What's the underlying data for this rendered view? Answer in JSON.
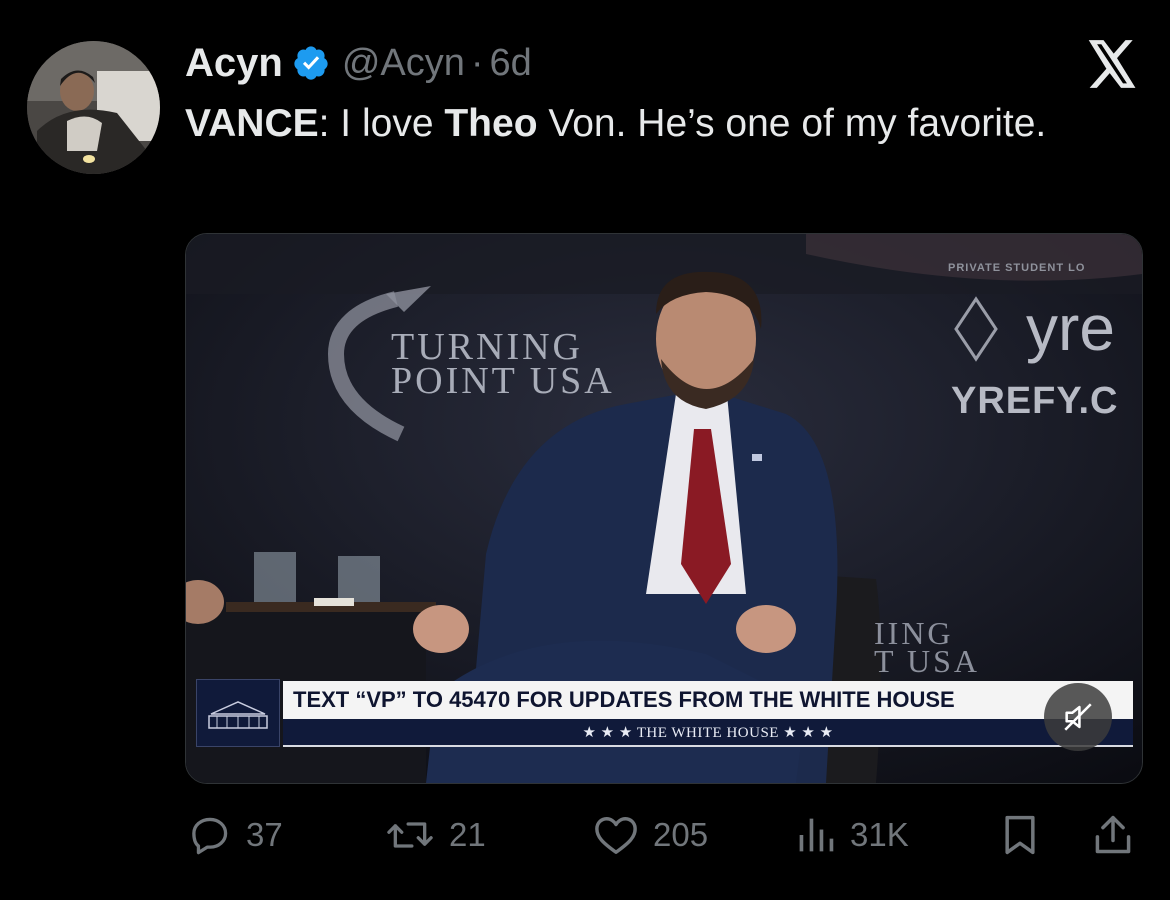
{
  "tweet": {
    "author_name": "Acyn",
    "author_handle": "@Acyn",
    "separator": "·",
    "age": "6d",
    "text_parts": {
      "p1_bold": "VANCE",
      "p2": ": I love ",
      "p3_bold": "Theo",
      "p4": " Von. He’s one of my favorite."
    }
  },
  "media": {
    "backdrop_left_line1": "TURNING",
    "backdrop_left_line2": "POINT USA",
    "backdrop_right_small": "PRIVATE STUDENT LO",
    "backdrop_right_logo": "yre",
    "backdrop_right_url": "YREFY.C",
    "backdrop_bottom_right_line1": "IING",
    "backdrop_bottom_right_line2": "T USA",
    "lower_third_main": "TEXT “VP” TO 45470 FOR UPDATES FROM THE WHITE HOUSE",
    "lower_third_sub": "★ ★ ★   THE WHITE HOUSE   ★ ★ ★"
  },
  "actions": {
    "replies": "37",
    "reposts": "21",
    "likes": "205",
    "views": "31K"
  },
  "colors": {
    "background": "#000000",
    "text_primary": "#e7e9ea",
    "text_secondary": "#71767b",
    "verified_blue": "#1d9bf0"
  }
}
